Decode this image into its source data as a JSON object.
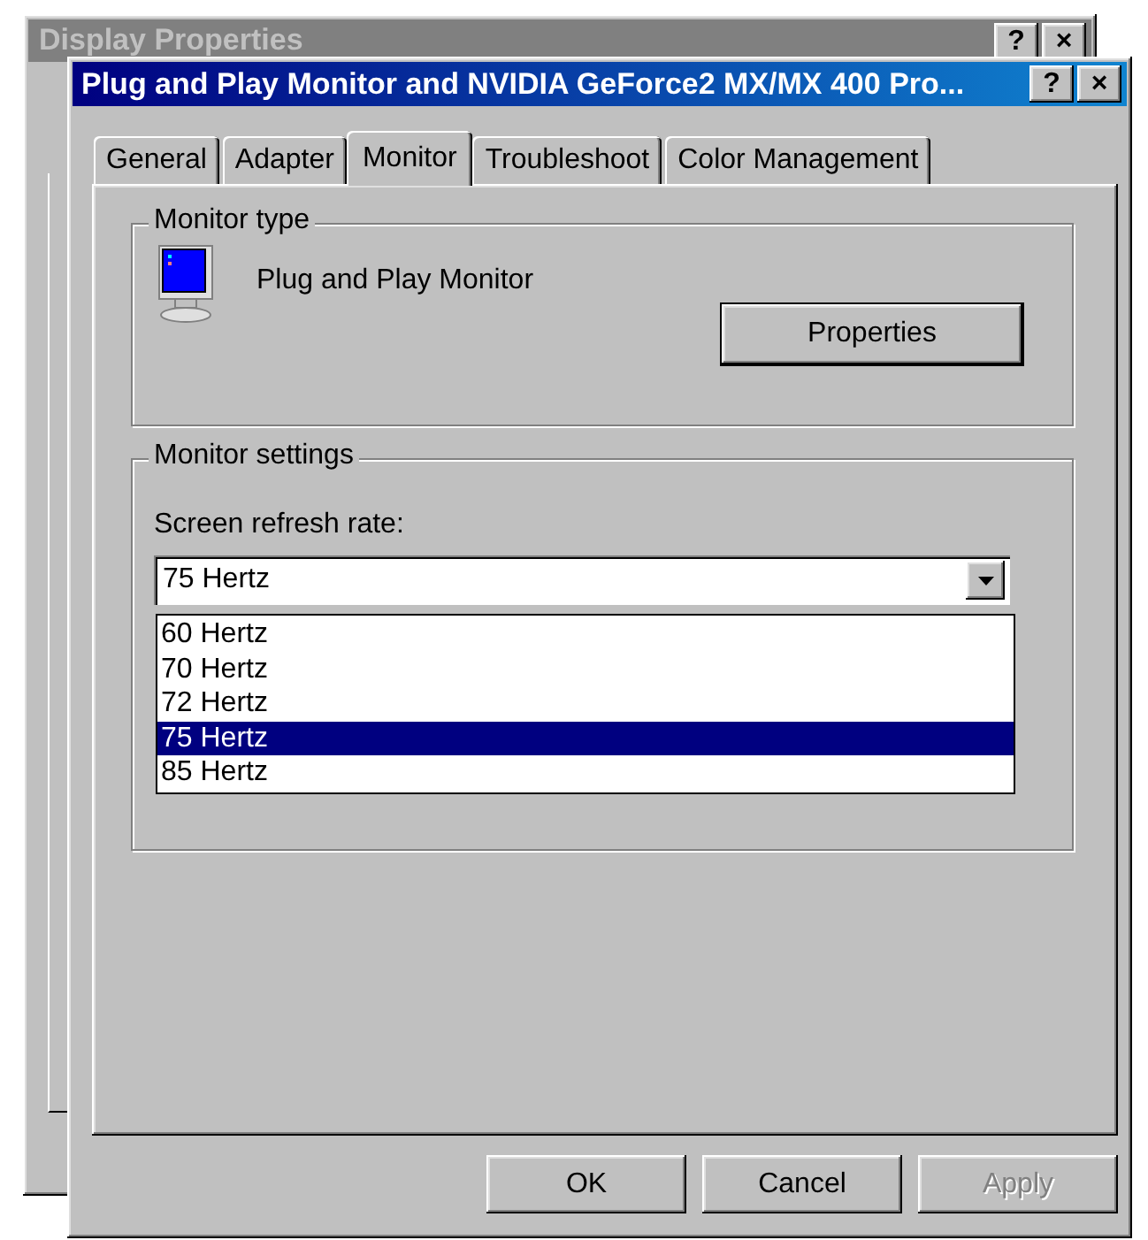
{
  "background_window": {
    "title": "Display Properties",
    "title_buttons": [
      "?",
      "×"
    ]
  },
  "window": {
    "title": "Plug and Play Monitor and NVIDIA GeForce2 MX/MX 400 Pro...",
    "title_buttons": [
      "?",
      "×"
    ]
  },
  "tabs": [
    {
      "label": "General",
      "selected": false
    },
    {
      "label": "Adapter",
      "selected": false
    },
    {
      "label": "Monitor",
      "selected": true
    },
    {
      "label": "Troubleshoot",
      "selected": false
    },
    {
      "label": "Color Management",
      "selected": false
    }
  ],
  "monitor_type": {
    "label": "Monitor type",
    "name": "Plug and Play Monitor",
    "button": "Properties"
  },
  "monitor_settings": {
    "label": "Monitor settings",
    "refresh_label": "Screen refresh rate:",
    "refresh_value": "75 Hertz",
    "expanded": true,
    "options": [
      {
        "label": "60 Hertz",
        "selected": false
      },
      {
        "label": "70 Hertz",
        "selected": false
      },
      {
        "label": "72 Hertz",
        "selected": false
      },
      {
        "label": "75 Hertz",
        "selected": true
      },
      {
        "label": "85 Hertz",
        "selected": false
      }
    ]
  },
  "buttons": [
    {
      "label": "OK",
      "disabled": false
    },
    {
      "label": "Cancel",
      "disabled": false
    },
    {
      "label": "Apply",
      "disabled": true
    }
  ]
}
